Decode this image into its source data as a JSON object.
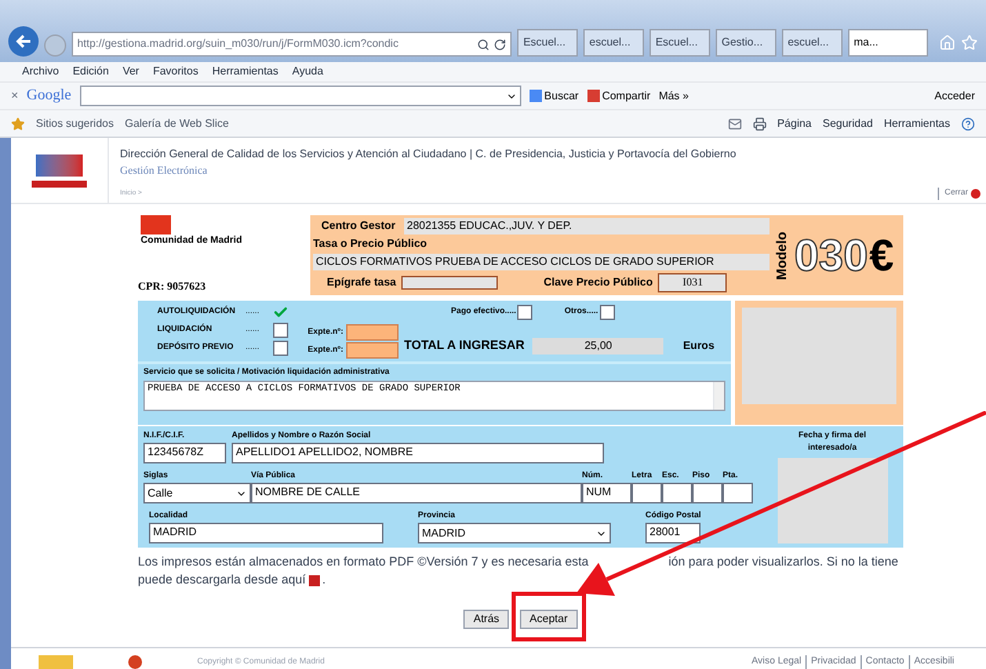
{
  "browser": {
    "address": "http://gestiona.madrid.org/suin_m030/run/j/FormM030.icm?condic",
    "tabs": [
      {
        "label": "Escuel...",
        "selected": false
      },
      {
        "label": "escuel...",
        "selected": false
      },
      {
        "label": "Escuel...",
        "selected": false
      },
      {
        "label": "Gestio...",
        "selected": false
      },
      {
        "label": "escuel...",
        "selected": false
      },
      {
        "label": "ma...",
        "selected": true
      }
    ],
    "menu": [
      "Archivo",
      "Edición",
      "Ver",
      "Favoritos",
      "Herramientas",
      "Ayuda"
    ],
    "google_bar": {
      "close": "×",
      "logo": "Google",
      "search_button": "Buscar",
      "share_button": "Compartir",
      "more": "Más »",
      "sign_in": "Acceder"
    },
    "favorites": [
      "Sitios sugeridos",
      "Galería de Web Slice"
    ],
    "commands": [
      "Página",
      "Seguridad",
      "Herramientas"
    ]
  },
  "site_header": {
    "title": "Dirección General de Calidad de los Servicios y Atención al Ciudadano | C. de Presidencia, Justicia y Portavocía del Gobierno",
    "subtitle": "Gestión Electrónica",
    "breadcrumb": "Inicio >",
    "close_link": "Cerrar"
  },
  "form": {
    "org": "Comunidad de Madrid",
    "cpr": "CPR: 9057623",
    "centro_gestor_label": "Centro Gestor",
    "centro_gestor": "28021355 EDUCAC.,JUV. Y DEP.",
    "tasa_label": "Tasa o Precio Público",
    "tasa": "CICLOS FORMATIVOS PRUEBA DE ACCESO CICLOS DE GRADO SUPERIOR",
    "epigrafe_label": "Epígrafe tasa",
    "clave_label": "Clave Precio Público",
    "clave": "I031",
    "modelo_label": "Modelo",
    "modelo_number": "030",
    "currency": "€",
    "liquidation_types": [
      {
        "label": "AUTOLIQUIDACIÓN",
        "dots": "......",
        "checked": true
      },
      {
        "label": "LIQUIDACIÓN",
        "dots": "......",
        "checked": false
      },
      {
        "label": "DEPÓSITO PREVIO",
        "dots": "......",
        "checked": false
      }
    ],
    "expte_labels": [
      "Expte.nº:",
      "Expte.nº:"
    ],
    "payment_options": [
      {
        "label": "Pago efectivo.....",
        "checked": false
      },
      {
        "label": "Otros.....",
        "checked": false
      }
    ],
    "total_label": "TOTAL A INGRESAR",
    "total": "25,00",
    "total_unit": "Euros",
    "service_label": "Servicio que se solicita / Motivación liquidación administrativa",
    "service": "PRUEBA DE ACCESO A CICLOS FORMATIVOS DE GRADO SUPERIOR",
    "signature_label": "Fecha y firma del interesado/a",
    "taxpayer_rows": [
      [
        {
          "label": "N.I.F./C.I.F.",
          "value": "12345678Z",
          "kind": "text"
        },
        {
          "label": "Apellidos y Nombre o Razón Social",
          "value": "APELLIDO1 APELLIDO2, NOMBRE",
          "kind": "text"
        }
      ],
      [
        {
          "label": "Siglas",
          "value": "Calle",
          "kind": "select"
        },
        {
          "label": "Vía Pública",
          "value": "NOMBRE DE CALLE",
          "kind": "text"
        },
        {
          "label": "Núm.",
          "value": "NUM",
          "kind": "text"
        },
        {
          "label": "Letra",
          "kind": "text"
        },
        {
          "label": "Esc.",
          "kind": "text"
        },
        {
          "label": "Piso",
          "kind": "text"
        },
        {
          "label": "Pta.",
          "kind": "text"
        }
      ],
      [
        {
          "label": "Localidad",
          "value": "MADRID",
          "kind": "text"
        },
        {
          "label": "Provincia",
          "value": "MADRID",
          "kind": "select"
        },
        {
          "label": "Código Postal",
          "value": "28001",
          "kind": "text"
        }
      ]
    ]
  },
  "notice": {
    "before_arrow": "Los impresos están almacenados en formato PDF ©Versión 7 y es necesaria esta",
    "after_arrow": "ión para poder visualizarlos. Si no la tiene",
    "second_line": "puede descargarla desde aquí",
    "end": "."
  },
  "buttons": [
    {
      "label": "Atrás",
      "highlighted": false
    },
    {
      "label": "Aceptar",
      "highlighted": true
    }
  ],
  "footer": {
    "copyright": "Copyright © Comunidad de Madrid",
    "links": [
      "Aviso Legal",
      "Privacidad",
      "Contacto",
      "Accesibili"
    ]
  }
}
